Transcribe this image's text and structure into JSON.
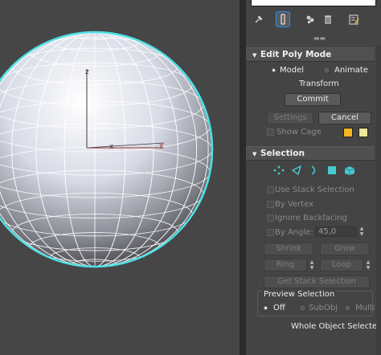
{
  "viewport": {
    "axis_labels": {
      "z": "z",
      "x": "x",
      "y": "y"
    }
  },
  "panel": {
    "tabs": [
      {
        "icon": "pin-icon",
        "active": false
      },
      {
        "icon": "modifier-stack-icon",
        "active": true
      },
      {
        "icon": "make-unique-icon",
        "active": false
      },
      {
        "icon": "remove-modifier-icon",
        "active": false
      },
      {
        "icon": "configure-sets-icon",
        "active": false
      }
    ],
    "edit_poly_mode": {
      "title": "Edit Poly Mode",
      "model_label": "Model",
      "animate_label": "Animate",
      "selected_mode": "Model",
      "transform_label": "Transform",
      "commit_label": "Commit",
      "settings_label": "Settings",
      "cancel_label": "Cancel",
      "show_cage_label": "Show Cage",
      "cage_colors": [
        "#f4b51f",
        "#ece79a"
      ]
    },
    "selection": {
      "title": "Selection",
      "sub_object_icons": [
        "vertex-icon",
        "edge-icon",
        "border-icon",
        "polygon-icon",
        "element-icon"
      ],
      "use_stack_selection_label": "Use Stack Selection",
      "by_vertex_label": "By Vertex",
      "ignore_backfacing_label": "Ignore Backfacing",
      "by_angle_label": "By Angle:",
      "by_angle_value": "45,0",
      "shrink_label": "Shrink",
      "grow_label": "Grow",
      "ring_label": "Ring",
      "loop_label": "Loop",
      "get_stack_selection_label": "Get Stack Selection",
      "preview_selection": {
        "title": "Preview Selection",
        "off_label": "Off",
        "subobj_label": "SubObj",
        "multi_label": "Multi",
        "selected": "Off"
      },
      "status_text": "Whole Object Selected"
    }
  },
  "colors": {
    "wireframe_highlight": "#4ee0e6",
    "accent_cyan": "#47c9d2",
    "active_tab_border": "#1e90ff"
  }
}
